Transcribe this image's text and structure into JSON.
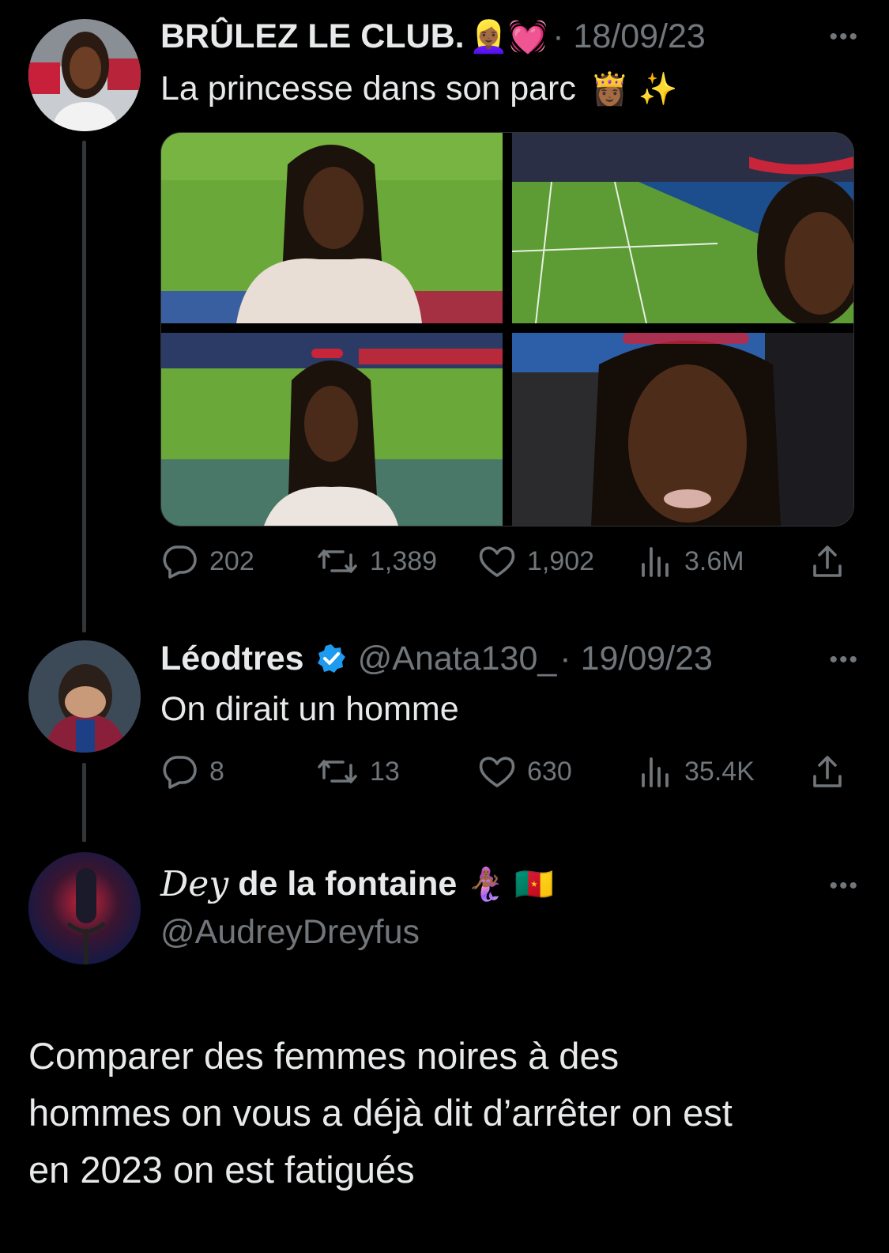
{
  "tweet1": {
    "name": "BRÛLEZ LE CLUB.",
    "name_emojis": "👱🏾‍♀️💓",
    "date": "· 18/09/23",
    "text": "La princesse dans son parc",
    "text_emojis": "👸🏾 ✨",
    "more": "•••",
    "stats": {
      "replies": "202",
      "retweets": "1,389",
      "likes": "1,902",
      "views": "3.6M"
    }
  },
  "tweet2": {
    "name": "Léodtres",
    "handle": "@Anata130_",
    "date": "· 19/09/23",
    "text": "On dirait un homme",
    "more": "•••",
    "stats": {
      "replies": "8",
      "retweets": "13",
      "likes": "630",
      "views": "35.4K"
    }
  },
  "tweet3": {
    "name_script": "Dey",
    "name": "de la fontaine",
    "name_emojis": "🧜🏾‍♀️ 🇨🇲",
    "handle": "@AudreyDreyfus",
    "more": "•••",
    "text_lines": [
      "Comparer des femmes noires à des",
      "hommes on vous a déjà dit d’arrêter on est",
      "en 2023 on est fatigués"
    ]
  },
  "colors": {
    "background": "#000000",
    "text": "#e7e9ea",
    "secondary": "#71767b",
    "verified": "#1d9bf0",
    "field": "#6aa83a"
  },
  "icons": [
    "reply-icon",
    "retweet-icon",
    "like-icon",
    "views-icon",
    "share-icon",
    "verified-badge-icon",
    "more-icon"
  ]
}
